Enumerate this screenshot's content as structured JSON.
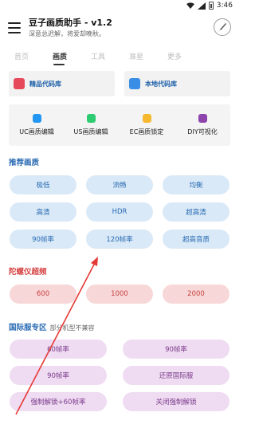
{
  "status_bar": {
    "time": "3:46"
  },
  "header": {
    "title": "豆子画质助手 - v1.2",
    "subtitle": "深意总迟解，将爱却晚秋。"
  },
  "tabs": [
    {
      "label": "首页",
      "active": false
    },
    {
      "label": "画质",
      "active": true
    },
    {
      "label": "工具",
      "active": false
    },
    {
      "label": "准星",
      "active": false
    },
    {
      "label": "更多",
      "active": false
    }
  ],
  "code_libs": [
    {
      "label": "精品代码库",
      "icon": "gem-library-icon",
      "color": "#e64a5a"
    },
    {
      "label": "本地代码库",
      "icon": "local-library-icon",
      "color": "#3a8ee6"
    }
  ],
  "tools": [
    {
      "label": "UC画质编辑",
      "icon": "uc-edit-icon",
      "color": "#2196f3"
    },
    {
      "label": "US画质编辑",
      "icon": "us-edit-icon",
      "color": "#2ecc71"
    },
    {
      "label": "EC画质锁定",
      "icon": "ec-lock-icon",
      "color": "#f5b82e"
    },
    {
      "label": "DIY可视化",
      "icon": "diy-visual-icon",
      "color": "#8e44ad"
    }
  ],
  "sections": {
    "recommended": {
      "title": "推荐画质",
      "color": "#2a6bb3"
    },
    "gyro": {
      "title": "陀螺仪超频",
      "color": "#d64545"
    },
    "intl": {
      "title": "国际服专区",
      "subtitle": "部分机型不兼容",
      "color": "#2a6bb3"
    }
  },
  "recommended_buttons": [
    [
      "极低",
      "流畅",
      "均衡"
    ],
    [
      "高清",
      "HDR",
      "超高清"
    ],
    [
      "90帧率",
      "120帧率",
      "超高音质"
    ]
  ],
  "gyro_buttons": [
    "600",
    "1000",
    "2000"
  ],
  "intl_buttons": [
    [
      "60帧率",
      "90帧率"
    ],
    [
      "90帧率",
      "还原国际服"
    ],
    [
      "强制解锁+60帧率",
      "关闭强制解锁"
    ]
  ],
  "annotation_color": "#e53935"
}
